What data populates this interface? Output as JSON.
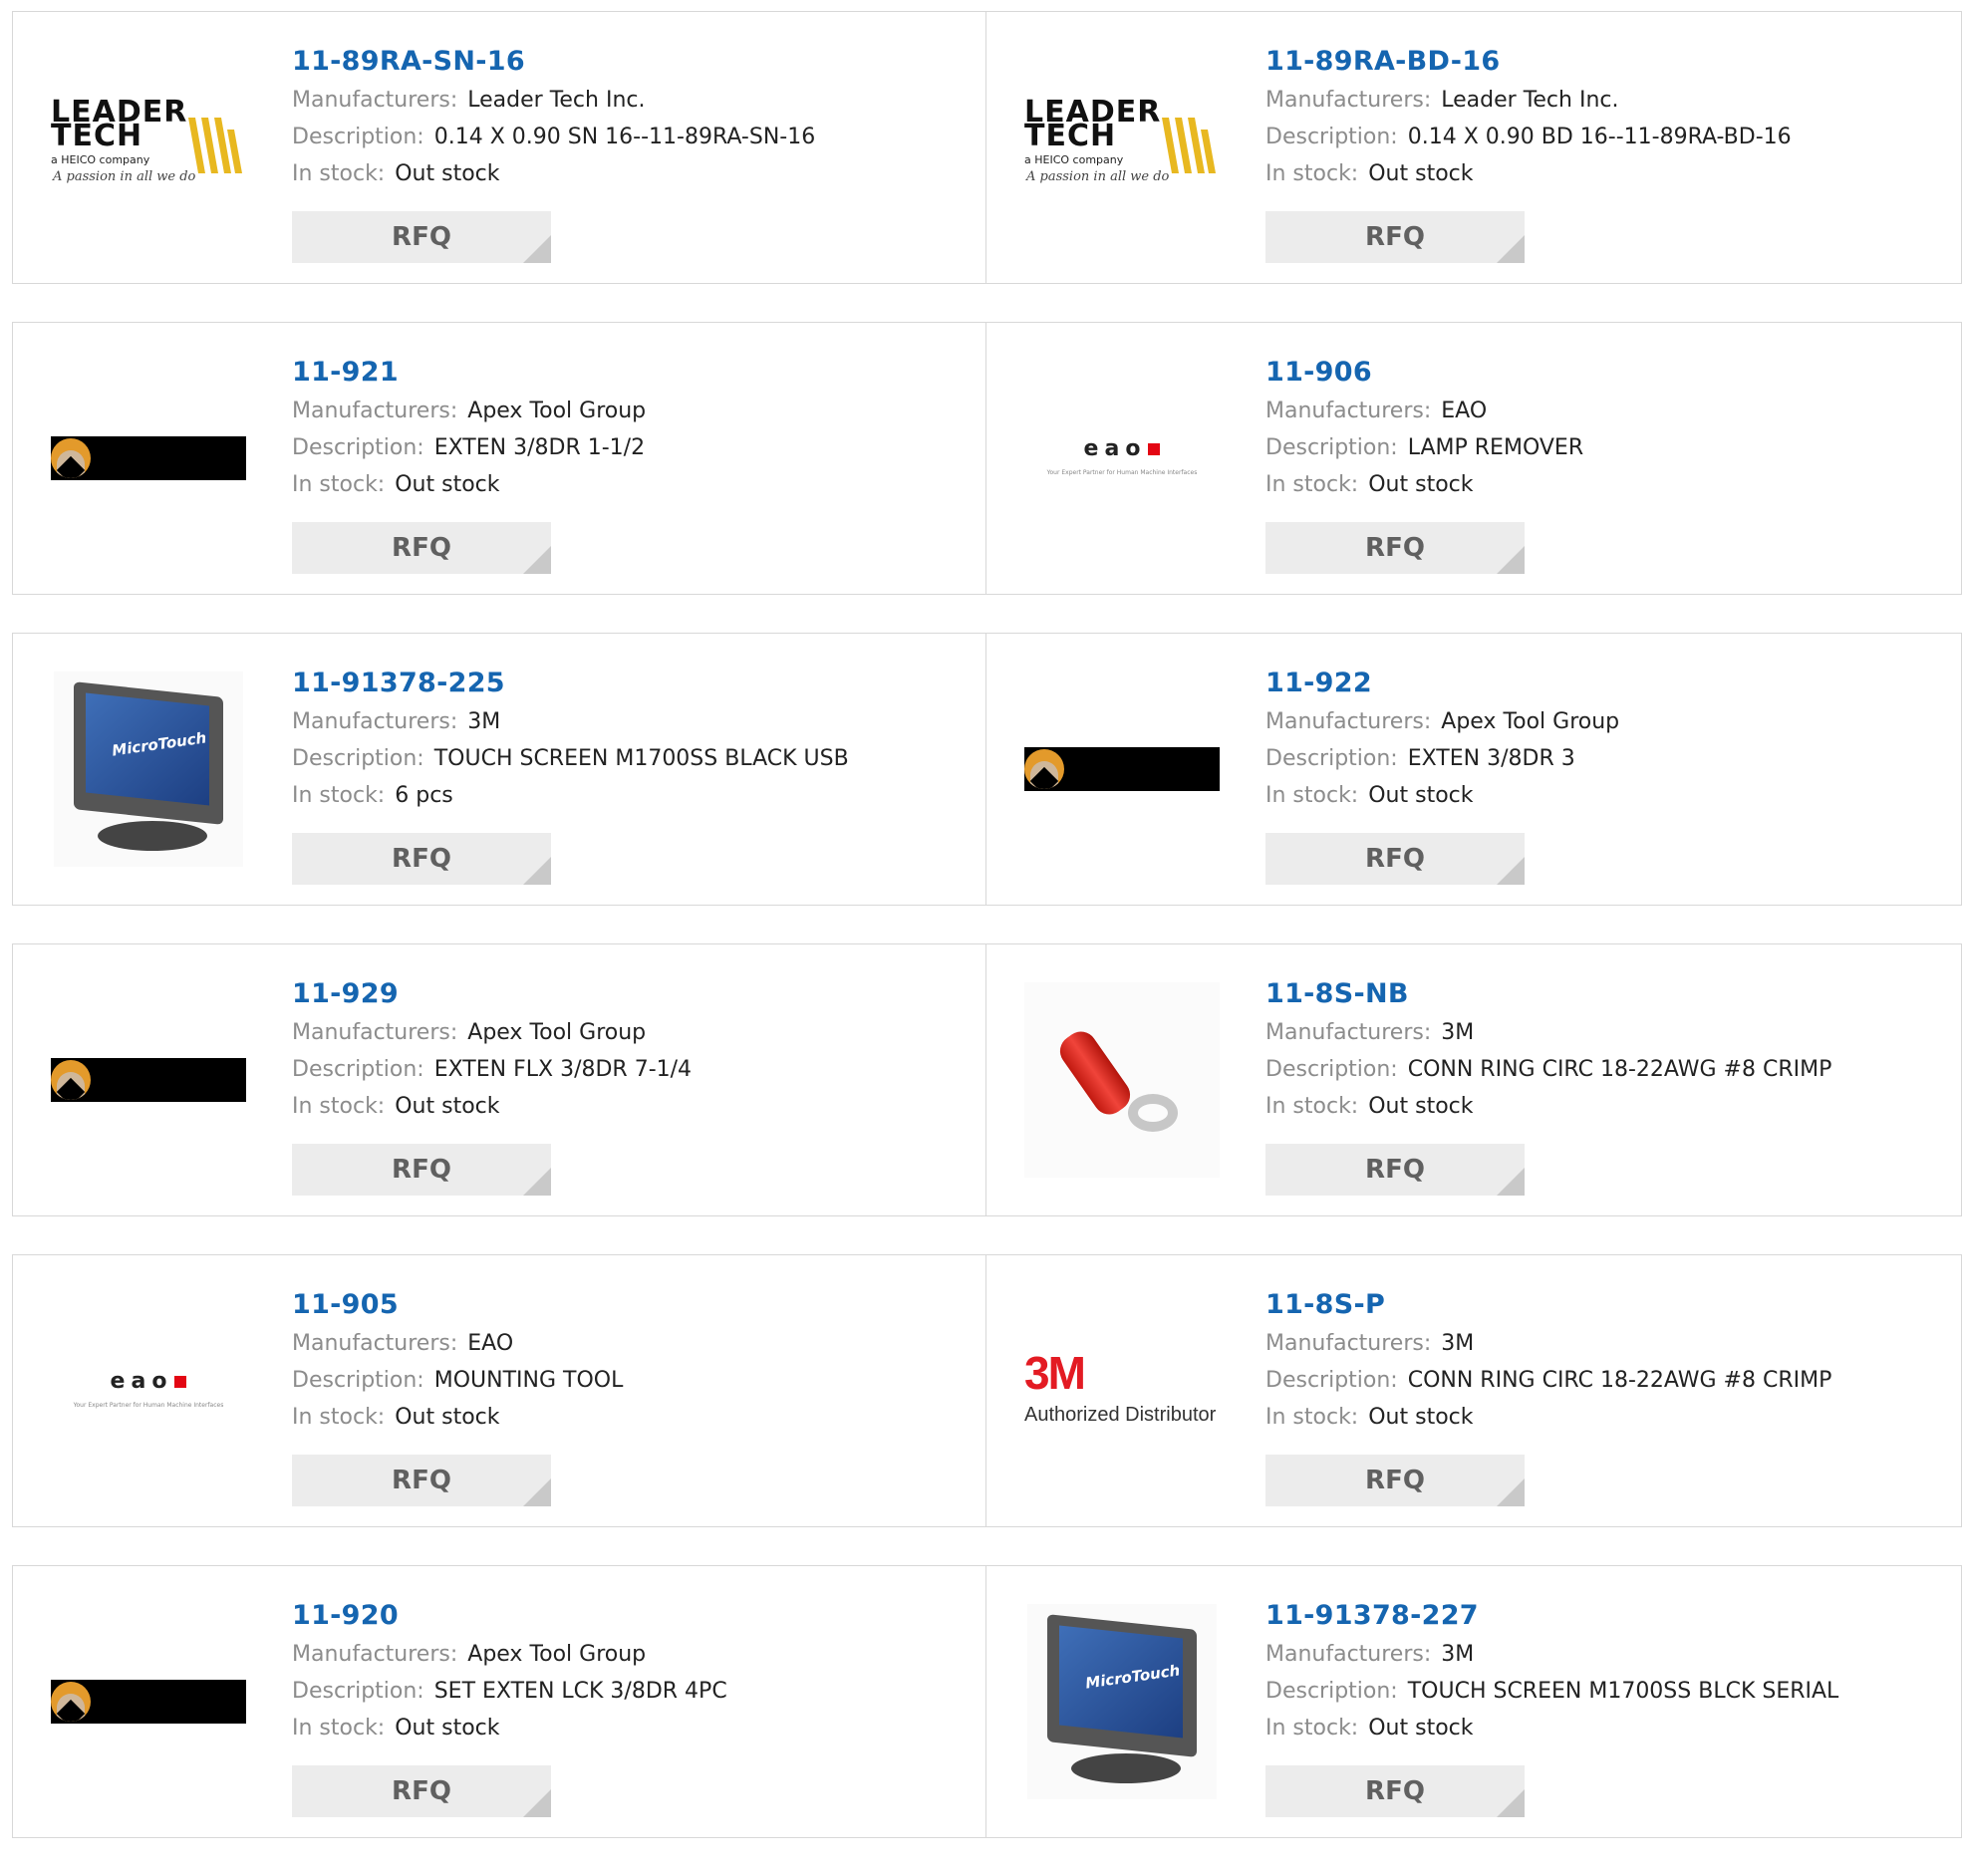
{
  "labels": {
    "manufacturers": "Manufacturers:",
    "description": "Description:",
    "in_stock": "In stock:",
    "rfq": "RFQ"
  },
  "logos": {
    "leader_tech": {
      "line1": "LEADER",
      "line2": "TECH",
      "sub": "a HEICO company",
      "tagline": "A passion in all we do"
    },
    "eao": {
      "word": "eao",
      "tagline": "Your Expert Partner for Human Machine Interfaces"
    },
    "microtouch": {
      "brand": "MicroTouch"
    },
    "3m": {
      "big": "3M",
      "sub": "Authorized Distributor"
    }
  },
  "products": [
    {
      "part": "11-89RA-SN-16",
      "manufacturer": "Leader Tech Inc.",
      "description": "0.14 X 0.90 SN 16--11-89RA-SN-16",
      "stock": "Out stock",
      "logo": "leader-tech-logo"
    },
    {
      "part": "11-89RA-BD-16",
      "manufacturer": "Leader Tech Inc.",
      "description": "0.14 X 0.90 BD 16--11-89RA-BD-16",
      "stock": "Out stock",
      "logo": "leader-tech-logo"
    },
    {
      "part": "11-921",
      "manufacturer": "Apex Tool Group",
      "description": "EXTEN 3/8DR 1-1/2",
      "stock": "Out stock",
      "logo": "apex-logo"
    },
    {
      "part": "11-906",
      "manufacturer": "EAO",
      "description": "LAMP REMOVER",
      "stock": "Out stock",
      "logo": "eao-logo"
    },
    {
      "part": "11-91378-225",
      "manufacturer": "3M",
      "description": "TOUCH SCREEN M1700SS BLACK USB",
      "stock": "6 pcs",
      "logo": "touch-monitor-image"
    },
    {
      "part": "11-922",
      "manufacturer": "Apex Tool Group",
      "description": "EXTEN 3/8DR 3",
      "stock": "Out stock",
      "logo": "apex-logo"
    },
    {
      "part": "11-929",
      "manufacturer": "Apex Tool Group",
      "description": "EXTEN FLX 3/8DR 7-1/4",
      "stock": "Out stock",
      "logo": "apex-logo"
    },
    {
      "part": "11-8S-NB",
      "manufacturer": "3M",
      "description": "CONN RING CIRC 18-22AWG #8 CRIMP",
      "stock": "Out stock",
      "logo": "ring-terminal-image"
    },
    {
      "part": "11-905",
      "manufacturer": "EAO",
      "description": "MOUNTING TOOL",
      "stock": "Out stock",
      "logo": "eao-logo"
    },
    {
      "part": "11-8S-P",
      "manufacturer": "3M",
      "description": "CONN RING CIRC 18-22AWG #8 CRIMP",
      "stock": "Out stock",
      "logo": "3m-logo"
    },
    {
      "part": "11-920",
      "manufacturer": "Apex Tool Group",
      "description": "SET EXTEN LCK 3/8DR 4PC",
      "stock": "Out stock",
      "logo": "apex-logo"
    },
    {
      "part": "11-91378-227",
      "manufacturer": "3M",
      "description": "TOUCH SCREEN M1700SS BLCK SERIAL",
      "stock": "Out stock",
      "logo": "touch-monitor-image"
    }
  ],
  "colors": {
    "part_link": "#1565b0",
    "label": "#8c8c8c",
    "value": "#222222",
    "border": "#d8d8d8",
    "rfq_bg": "#ececec",
    "leader_yellow": "#e8b820",
    "eao_red": "#e30613",
    "apex_orange": "#e39a2b",
    "brand_3m_red": "#e31b23"
  }
}
